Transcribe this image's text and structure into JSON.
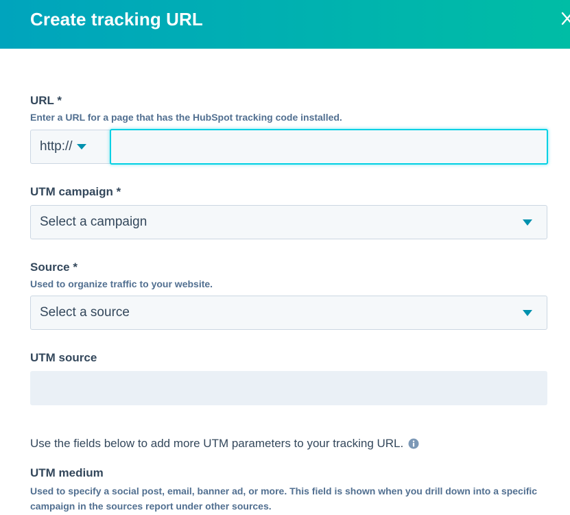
{
  "header": {
    "title": "Create tracking URL",
    "close_icon": "close-icon"
  },
  "url_field": {
    "label": "URL *",
    "help": "Enter a URL for a page that has the HubSpot tracking code installed.",
    "protocol": "http://",
    "value": "",
    "placeholder": ""
  },
  "utm_campaign": {
    "label": "UTM campaign *",
    "selected": "Select a campaign"
  },
  "source": {
    "label": "Source *",
    "help": "Used to organize traffic to your website.",
    "selected": "Select a source"
  },
  "utm_source": {
    "label": "UTM source",
    "value": ""
  },
  "info": {
    "text": "Use the fields below to add more UTM parameters to your tracking URL.",
    "icon": "info-icon"
  },
  "utm_medium": {
    "label": "UTM medium",
    "help": "Used to specify a social post, email, banner ad, or more. This field is shown when you drill down into a specific campaign in the sources report under other sources."
  },
  "colors": {
    "header_start": "#00a4bd",
    "header_end": "#00bda5",
    "focus_border": "#00d0e4",
    "caret": "#0091ae",
    "text": "#33475b"
  }
}
